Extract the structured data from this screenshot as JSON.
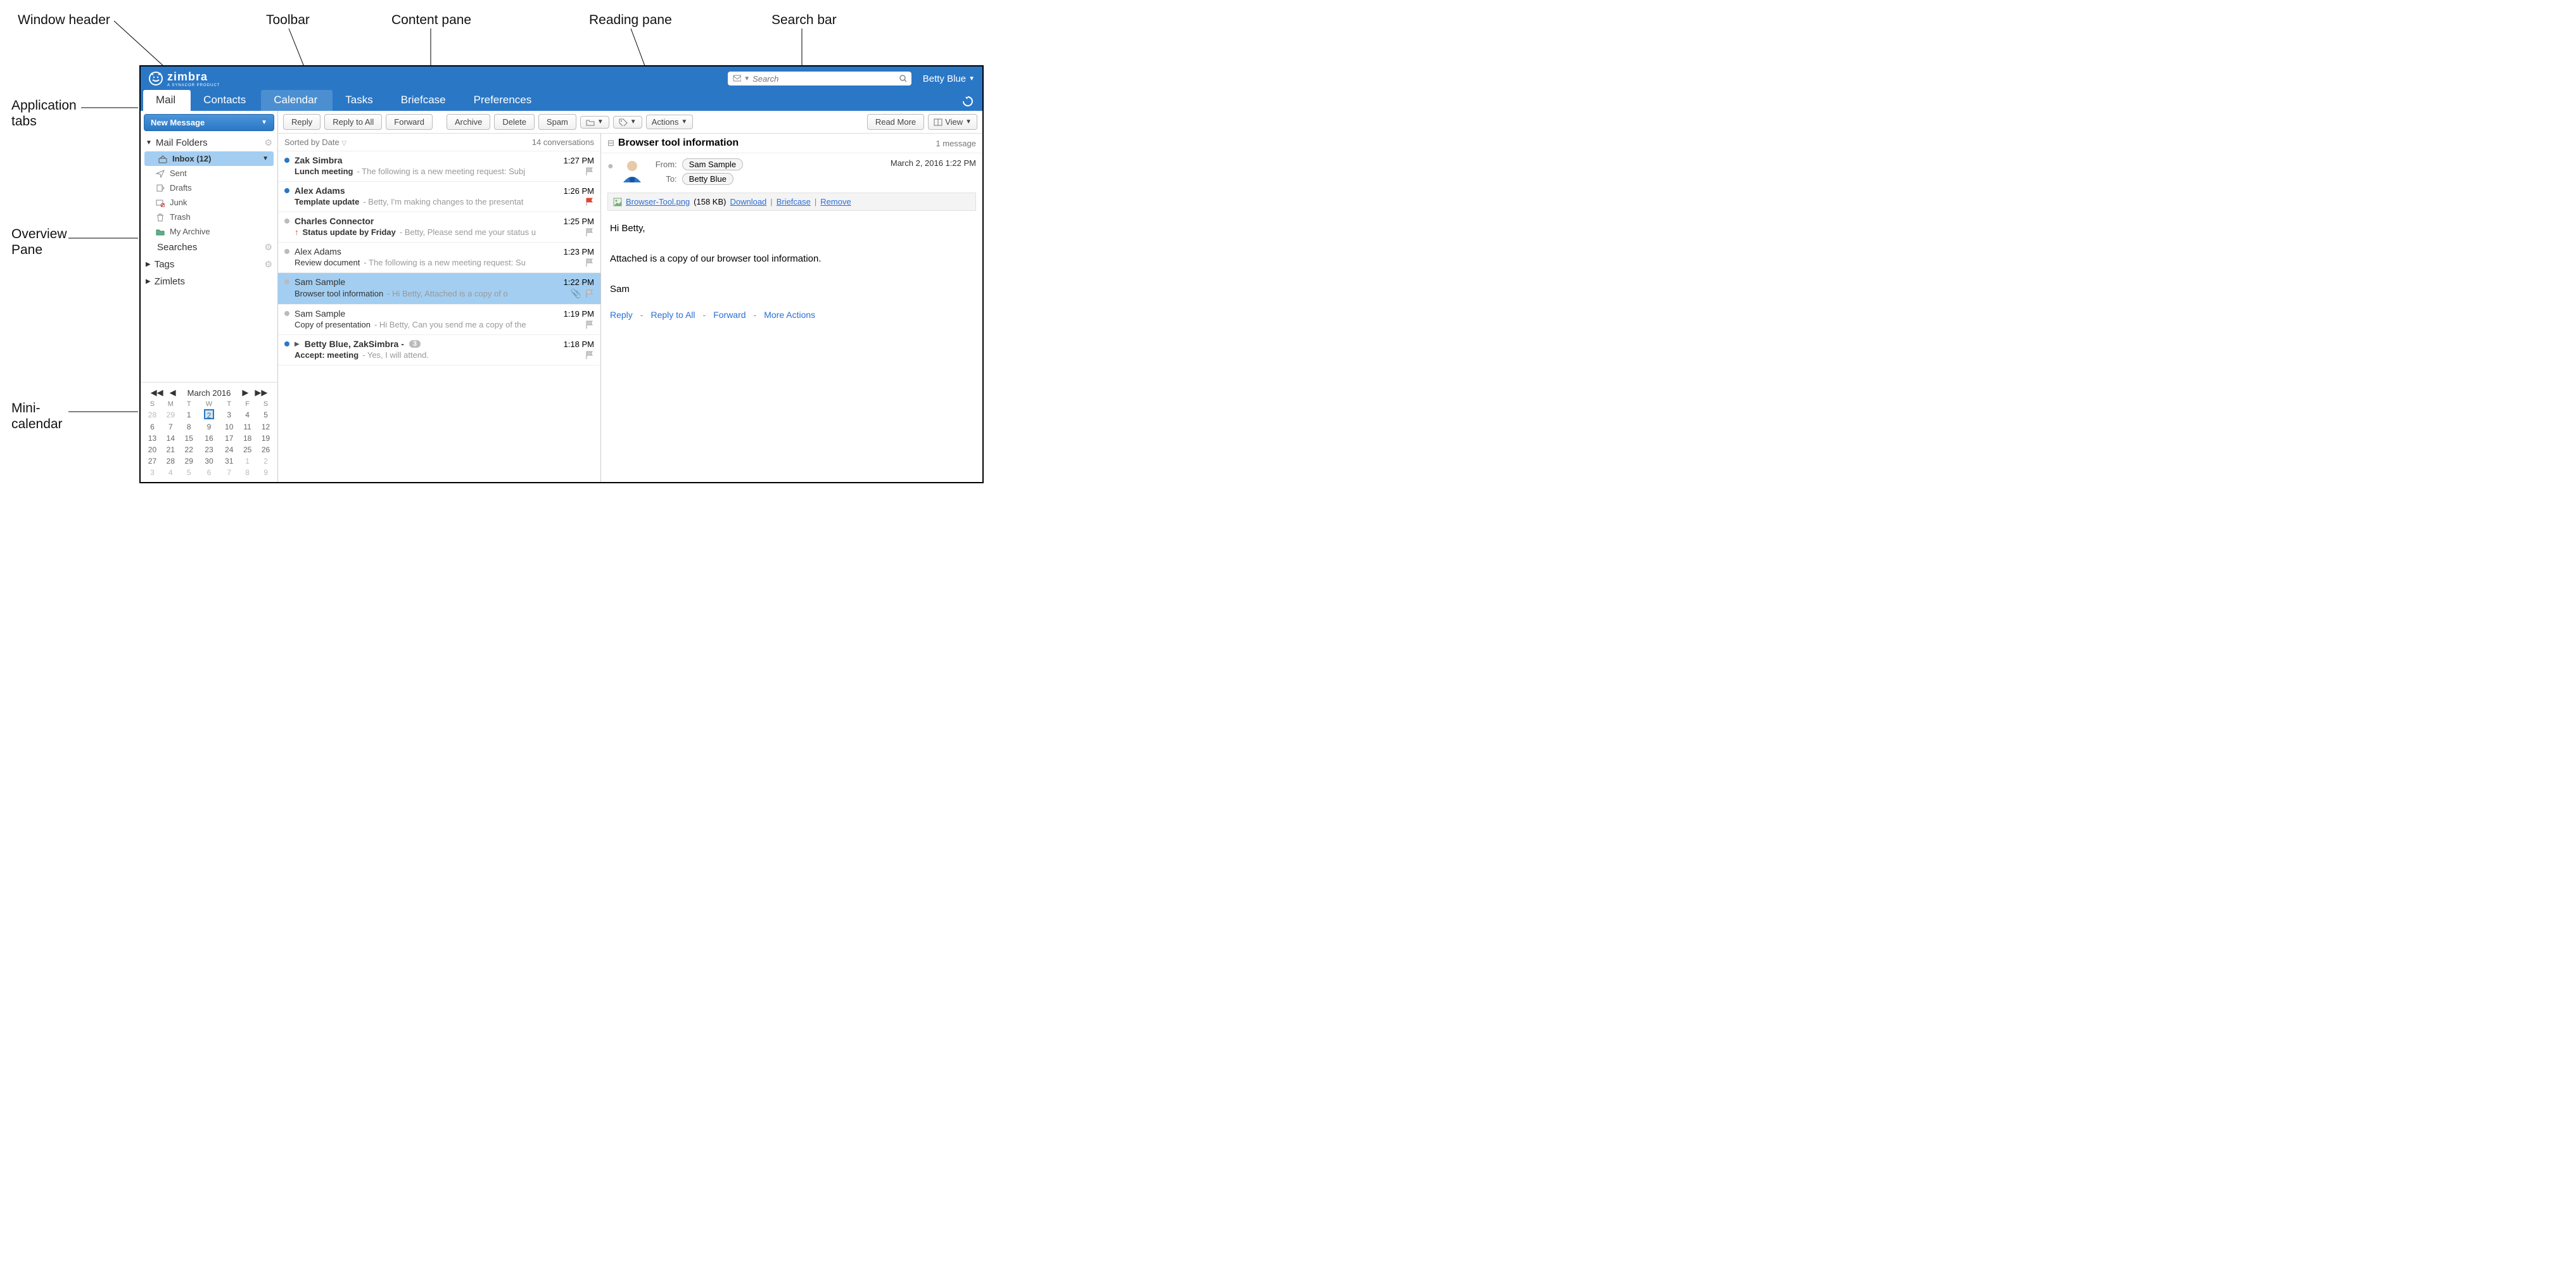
{
  "callouts": {
    "window_header": "Window header",
    "toolbar": "Toolbar",
    "content_pane": "Content pane",
    "reading_pane": "Reading pane",
    "search_bar": "Search bar",
    "application_tabs_l1": "Application",
    "application_tabs_l2": "tabs",
    "overview_pane_l1": "Overview",
    "overview_pane_l2": "Pane",
    "mini_calendar_l1": "Mini-",
    "mini_calendar_l2": "calendar"
  },
  "brand": "zimbra",
  "brand_sub": "A SYNACOR PRODUCT",
  "search": {
    "placeholder": "Search"
  },
  "user_name": "Betty Blue",
  "tabs": [
    "Mail",
    "Contacts",
    "Calendar",
    "Tasks",
    "Briefcase",
    "Preferences"
  ],
  "new_message_btn": "New Message",
  "sections": {
    "mail_folders": "Mail Folders",
    "searches": "Searches",
    "tags": "Tags",
    "zimlets": "Zimlets"
  },
  "folders": {
    "inbox": "Inbox (12)",
    "sent": "Sent",
    "drafts": "Drafts",
    "junk": "Junk",
    "trash": "Trash",
    "my_archive": "My Archive"
  },
  "minical": {
    "month": "March 2016",
    "dow": [
      "S",
      "M",
      "T",
      "W",
      "T",
      "F",
      "S"
    ],
    "weeks": [
      [
        "28",
        "29",
        "1",
        "2",
        "3",
        "4",
        "5"
      ],
      [
        "6",
        "7",
        "8",
        "9",
        "10",
        "11",
        "12"
      ],
      [
        "13",
        "14",
        "15",
        "16",
        "17",
        "18",
        "19"
      ],
      [
        "20",
        "21",
        "22",
        "23",
        "24",
        "25",
        "26"
      ],
      [
        "27",
        "28",
        "29",
        "30",
        "31",
        "1",
        "2"
      ],
      [
        "3",
        "4",
        "5",
        "6",
        "7",
        "8",
        "9"
      ]
    ],
    "today": "2"
  },
  "toolbar": {
    "reply": "Reply",
    "reply_all": "Reply to All",
    "forward": "Forward",
    "archive": "Archive",
    "delete": "Delete",
    "spam": "Spam",
    "actions": "Actions",
    "read_more": "Read More",
    "view": "View"
  },
  "sort_header": {
    "left": "Sorted by Date",
    "right": "14 conversations"
  },
  "messages": [
    {
      "sender": "Zak Simbra",
      "time": "1:27 PM",
      "subject": "Lunch meeting",
      "preview": "- The following is a new meeting request: Subj",
      "unread": true,
      "bold": true,
      "flag": "gray"
    },
    {
      "sender": "Alex Adams",
      "time": "1:26 PM",
      "subject": "Template update",
      "preview": "- Betty, I'm making changes to the presentat",
      "unread": true,
      "bold": true,
      "flag": "red"
    },
    {
      "sender": "Charles Connector",
      "time": "1:25 PM",
      "subject": "Status update by Friday",
      "preview": "- Betty, Please send me your status u",
      "unread": false,
      "bold": true,
      "flag": "gray",
      "priority": "high"
    },
    {
      "sender": "Alex Adams",
      "time": "1:23 PM",
      "subject": "Review document",
      "preview": "- The following is a new meeting request: Su",
      "unread": false,
      "bold": false,
      "flag": "gray"
    },
    {
      "sender": "Sam Sample",
      "time": "1:22 PM",
      "subject": "Browser tool information",
      "preview": "- Hi Betty, Attached is a copy of o",
      "unread": false,
      "bold": false,
      "flag": "gray",
      "attach": true,
      "selected": true
    },
    {
      "sender": "Sam Sample",
      "time": "1:19 PM",
      "subject": "Copy of presentation",
      "preview": "- Hi Betty, Can you send me a copy of the",
      "unread": false,
      "bold": false,
      "flag": "gray"
    },
    {
      "sender": "Betty Blue, ZakSimbra -",
      "time": "1:18 PM",
      "subject": "Accept: meeting",
      "preview": "- Yes, I will attend.",
      "unread": true,
      "bold": true,
      "flag": "gray",
      "thread_count": "3",
      "expander": true
    }
  ],
  "reading": {
    "title": "Browser tool information",
    "count": "1 message",
    "from_lbl": "From:",
    "to_lbl": "To:",
    "from": "Sam Sample",
    "to": "Betty Blue",
    "date": "March 2, 2016 1:22 PM",
    "attachment_name": "Browser-Tool.png",
    "attachment_size": "(158 KB)",
    "download": "Download",
    "briefcase": "Briefcase",
    "remove": "Remove",
    "body_line1": "Hi Betty,",
    "body_line2": "Attached is a copy of our browser tool information.",
    "body_line3": "Sam",
    "actions": {
      "reply": "Reply",
      "reply_all": "Reply to All",
      "forward": "Forward",
      "more": "More Actions"
    }
  }
}
